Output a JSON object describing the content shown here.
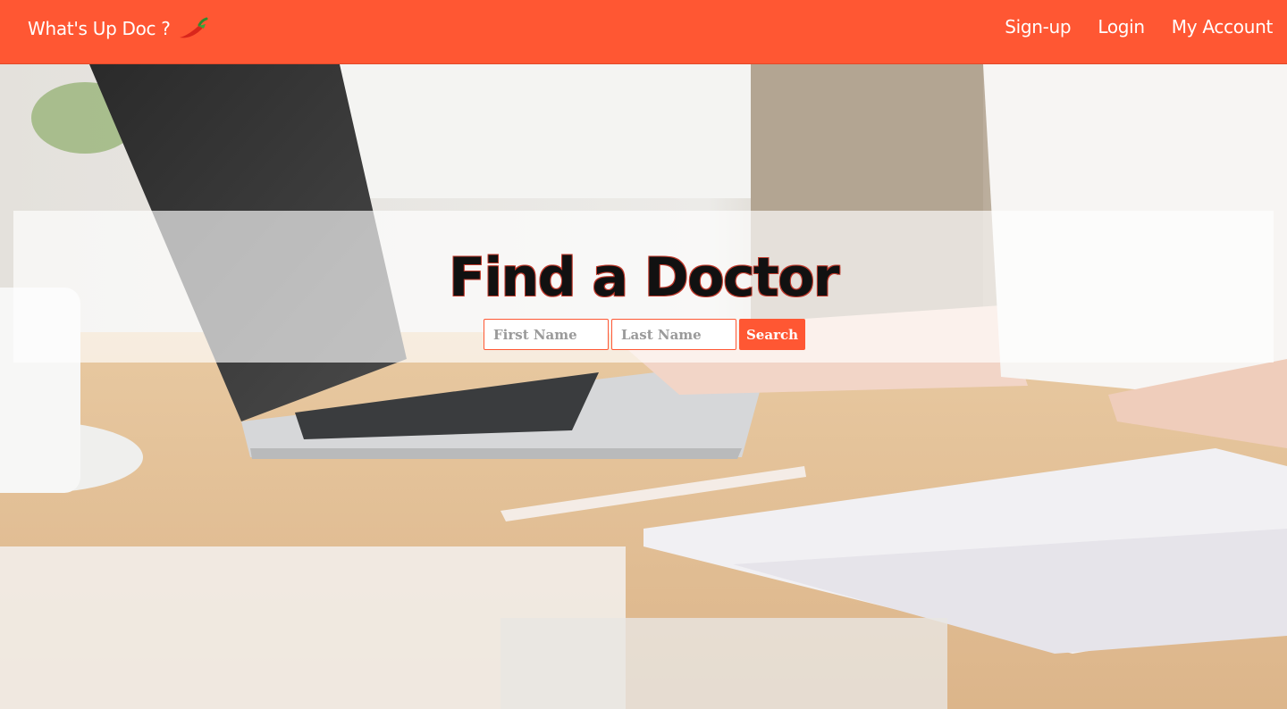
{
  "app": {
    "brand": "What's Up Doc ?",
    "brand_icon": "chili-pepper-icon"
  },
  "nav": {
    "signup": "Sign-up",
    "login": "Login",
    "account": "My Account"
  },
  "hero": {
    "title": "Find a Doctor"
  },
  "search": {
    "first_name_placeholder": "First Name",
    "last_name_placeholder": "Last Name",
    "button_label": "Search"
  },
  "colors": {
    "accent": "#ff5733",
    "banner": "#ffffff",
    "title_text": "#111111",
    "title_outline": "#c0392b"
  }
}
